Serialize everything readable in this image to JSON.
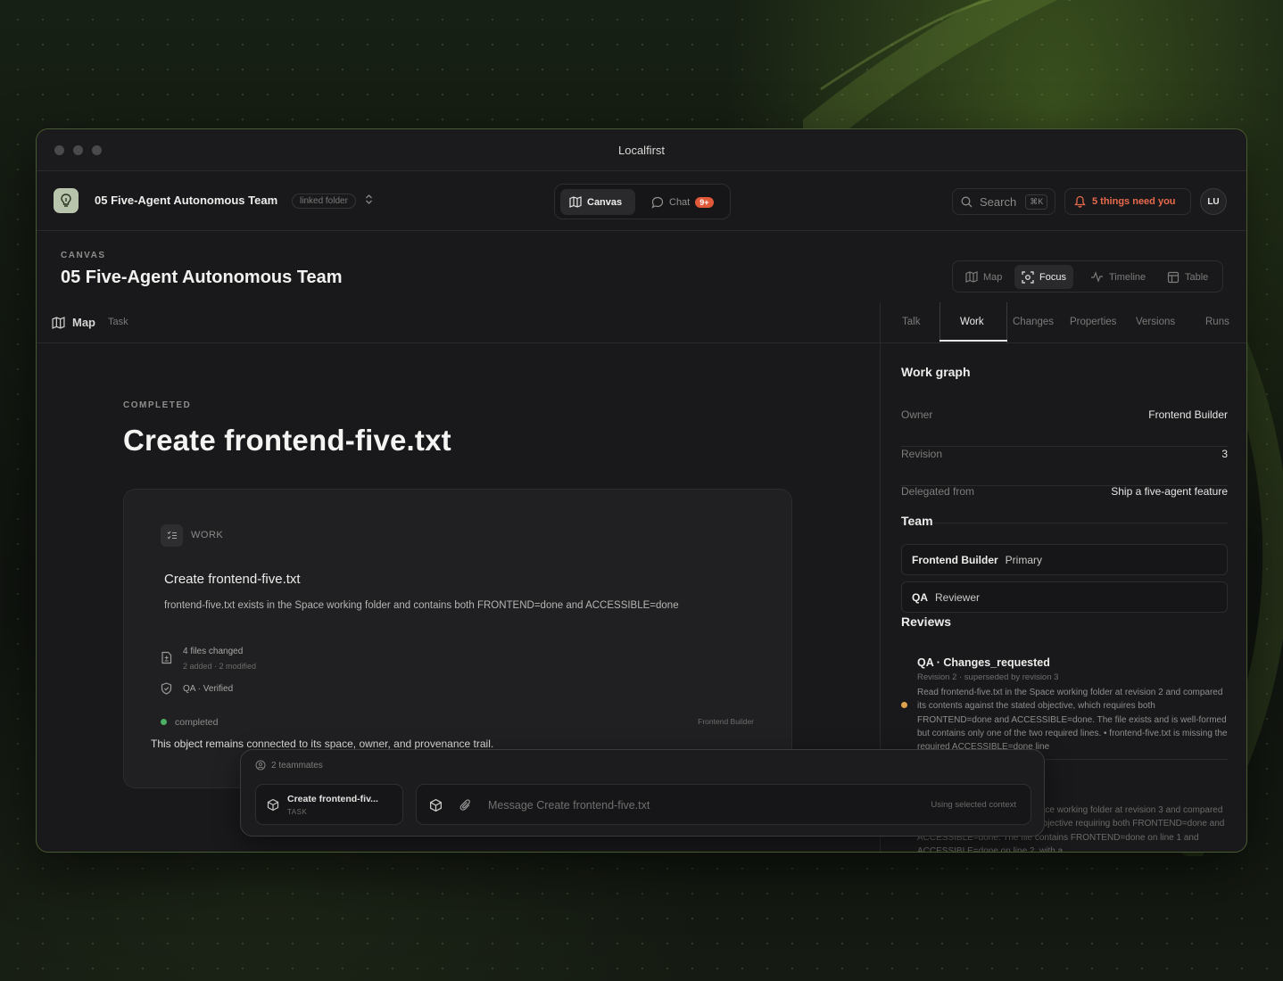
{
  "window": {
    "title": "Localfirst"
  },
  "topbar": {
    "space_name": "05 Five-Agent Autonomous Team",
    "space_tag": "linked folder",
    "modes": [
      {
        "label": "Canvas",
        "icon": "map-icon",
        "active": true
      },
      {
        "label": "Chat",
        "icon": "chat-bubble-icon",
        "badge": "9+"
      }
    ],
    "search": {
      "label": "Search",
      "shortcut": "⌘K"
    },
    "attention": "5 things need you",
    "avatar": "LU"
  },
  "canvas": {
    "kicker": "CANVAS",
    "title": "05 Five-Agent Autonomous Team",
    "views": [
      {
        "label": "Map"
      },
      {
        "label": "Focus",
        "active": true
      },
      {
        "label": "Timeline"
      },
      {
        "label": "Table"
      }
    ]
  },
  "breadcrumb": {
    "map": "Map",
    "task": "Task"
  },
  "main": {
    "status_kicker": "COMPLETED",
    "title": "Create frontend-five.txt",
    "card": {
      "kicker": "WORK",
      "title": "Create frontend-five.txt",
      "description": "frontend-five.txt exists in the Space working folder and contains both FRONTEND=done and ACCESSIBLE=done",
      "files_changed": "4 files changed",
      "files_detail": "2 added · 2 modified",
      "verification": "QA · Verified",
      "status": "completed",
      "owner": "Frontend Builder",
      "provenance": "This object remains connected to its space, owner, and provenance trail."
    }
  },
  "panel": {
    "tabs": [
      "Talk",
      "Work",
      "Changes",
      "Properties",
      "Versions",
      "Runs"
    ],
    "active_tab": "Work",
    "work_graph_title": "Work graph",
    "fields": [
      {
        "key": "Owner",
        "value": "Frontend Builder"
      },
      {
        "key": "Revision",
        "value": "3"
      },
      {
        "key": "Delegated from",
        "value": "Ship a five-agent feature"
      }
    ],
    "team_title": "Team",
    "team": [
      {
        "name": "Frontend Builder",
        "role": "Primary"
      },
      {
        "name": "QA",
        "role": "Reviewer"
      }
    ],
    "reviews_title": "Reviews",
    "reviews": [
      {
        "title": "QA · Changes_requested",
        "meta": "Revision 2 · superseded by revision 3",
        "body": "Read frontend-five.txt in the Space working folder at revision 2 and compared its contents against the stated objective, which requires both FRONTEND=done and ACCESSIBLE=done. The file exists and is well-formed but contains only one of the two required lines. • frontend-five.txt is missing the required ACCESSIBLE=done line",
        "status_color": "#e0a24a"
      },
      {
        "body": "Read frontend-five.txt in the Space working folder at revision 3 and compared its contents against the stated objective requiring both FRONTEND=done and ACCESSIBLE=done. The file contains FRONTEND=done on line 1 and ACCESSIBLE=done on line 2, with a"
      }
    ]
  },
  "composer": {
    "teammates": "2 teammates",
    "context_chip": {
      "title": "Create frontend-fiv...",
      "type": "TASK"
    },
    "placeholder": "Message Create frontend-five.txt",
    "context_note": "Using selected context"
  },
  "colors": {
    "accent_green": "#4caf63",
    "attention_red": "#e96a4c",
    "badge_red": "#e05a3a",
    "review_amber": "#e0a24a",
    "window_border": "#4a5a30"
  }
}
